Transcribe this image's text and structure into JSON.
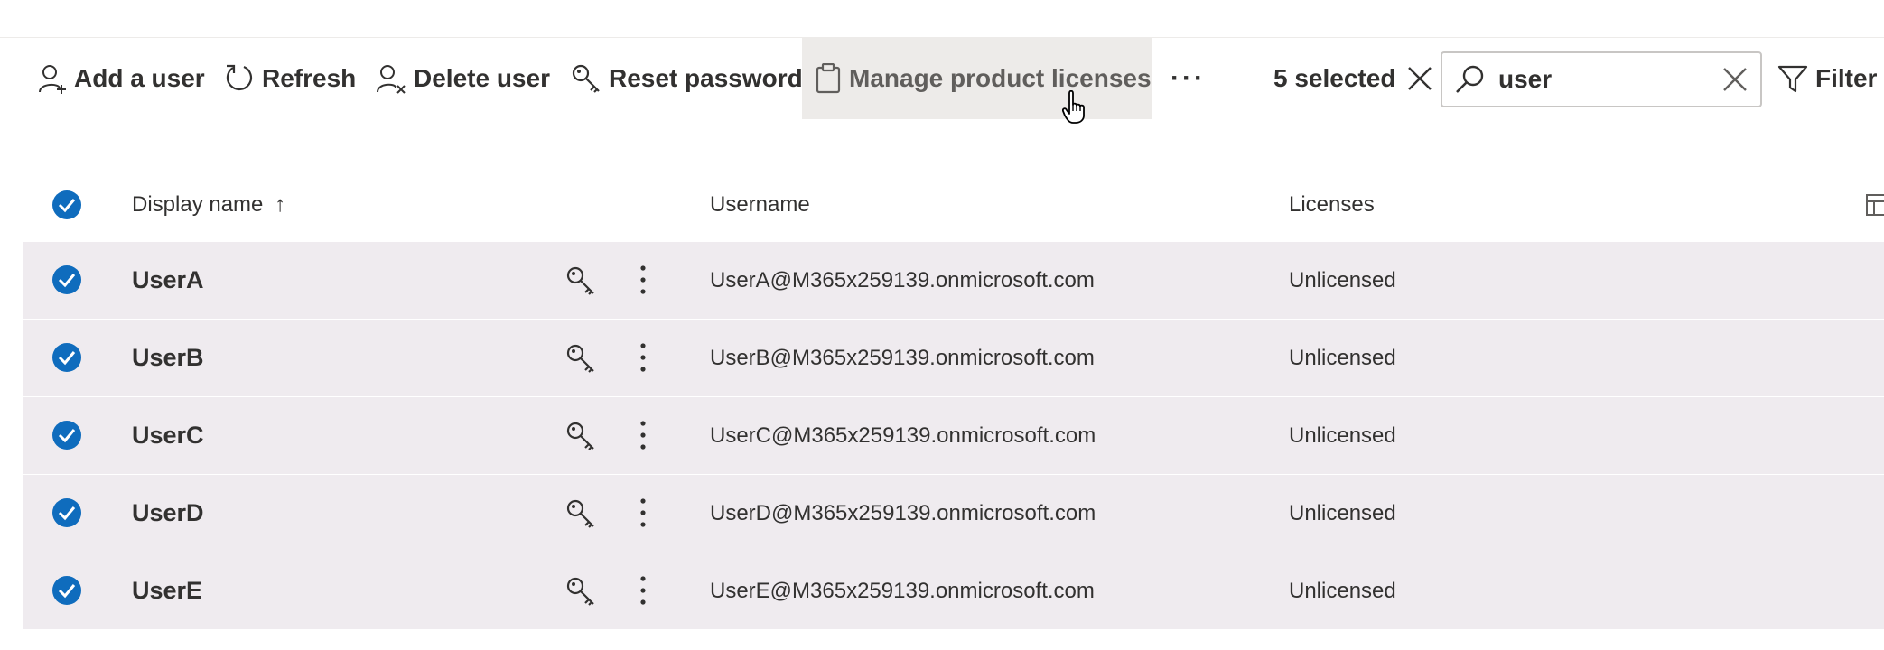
{
  "toolbar": {
    "add_user": "Add a user",
    "refresh": "Refresh",
    "delete_user": "Delete user",
    "reset_password": "Reset password",
    "manage_licenses": "Manage product licenses",
    "more": "···",
    "selected_count": "5 selected",
    "filter": "Filter"
  },
  "search": {
    "value": "user"
  },
  "columns": {
    "display_name": "Display name",
    "sort_indicator": "↑",
    "username": "Username",
    "licenses": "Licenses"
  },
  "rows": [
    {
      "name": "UserA",
      "username": "UserA@M365x259139.onmicrosoft.com",
      "licenses": "Unlicensed",
      "selected": true
    },
    {
      "name": "UserB",
      "username": "UserB@M365x259139.onmicrosoft.com",
      "licenses": "Unlicensed",
      "selected": true
    },
    {
      "name": "UserC",
      "username": "UserC@M365x259139.onmicrosoft.com",
      "licenses": "Unlicensed",
      "selected": true
    },
    {
      "name": "UserD",
      "username": "UserD@M365x259139.onmicrosoft.com",
      "licenses": "Unlicensed",
      "selected": true
    },
    {
      "name": "UserE",
      "username": "UserE@M365x259139.onmicrosoft.com",
      "licenses": "Unlicensed",
      "selected": true
    }
  ],
  "colors": {
    "accent": "#0f6cbd",
    "row_selected": "#efebef",
    "text": "#323130",
    "hover": "#edebe9"
  },
  "icons": [
    "add-user-icon",
    "refresh-icon",
    "delete-user-icon",
    "key-icon",
    "clipboard-icon",
    "close-icon",
    "search-icon",
    "filter-icon",
    "checkmark-icon",
    "more-vertical-icon",
    "column-options-icon",
    "hand-pointer-icon"
  ]
}
